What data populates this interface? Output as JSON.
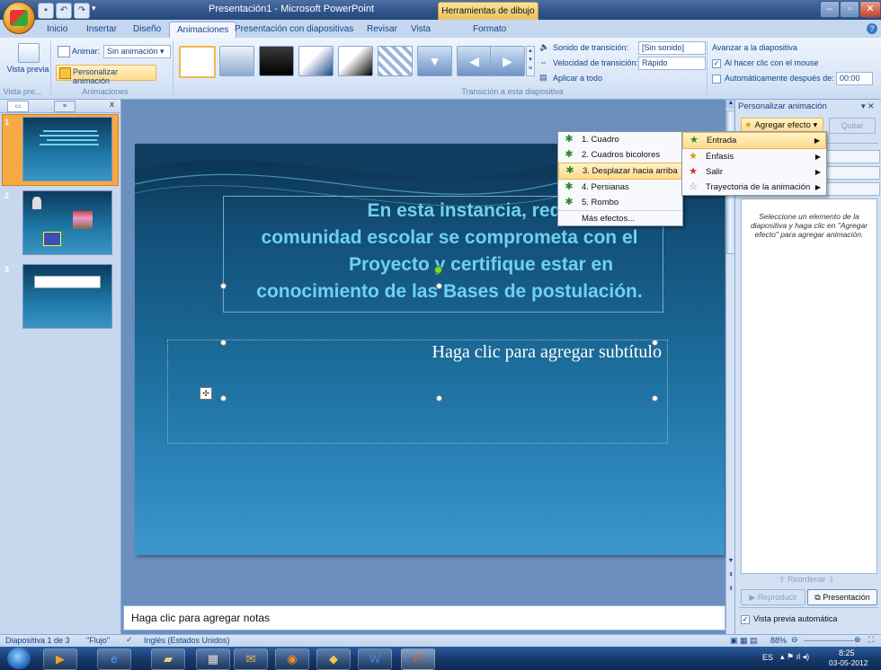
{
  "window": {
    "title": "Presentación1 - Microsoft PowerPoint",
    "contextual_tab_group": "Herramientas de dibujo"
  },
  "tabs": [
    {
      "label": "Inicio"
    },
    {
      "label": "Insertar"
    },
    {
      "label": "Diseño"
    },
    {
      "label": "Animaciones"
    },
    {
      "label": "Presentación con diapositivas"
    },
    {
      "label": "Revisar"
    },
    {
      "label": "Vista"
    },
    {
      "label": "Formato"
    }
  ],
  "ribbon": {
    "preview_label": "Vista previa",
    "preview_group": "Vista pre...",
    "animar_label": "Animar:",
    "animar_value": "Sin animación",
    "personalizar_label": "Personalizar animación",
    "animaciones_group": "Animaciones",
    "sonido_label": "Sonido de transición:",
    "sonido_value": "[Sin sonido]",
    "velocidad_label": "Velocidad de transición:",
    "velocidad_value": "Rápido",
    "aplicar_label": "Aplicar a todo",
    "transicion_group": "Transición a esta diapositiva",
    "avanzar_label": "Avanzar a la diapositiva",
    "al_hacer_clic": "Al hacer clic con el mouse",
    "auto_label": "Automáticamente después de:",
    "auto_value": "00:00"
  },
  "slides": [
    {
      "num": "1"
    },
    {
      "num": "2"
    },
    {
      "num": "3"
    }
  ],
  "slide": {
    "title_lines": [
      "En esta instancia, requerim",
      "comunidad escolar se comprometa con el",
      "Proyecto y certifique estar en",
      "conocimiento de las Bases de postulación."
    ],
    "subtitle_placeholder": "Haga clic para agregar subtítulo"
  },
  "notes_placeholder": "Haga clic para agregar notas",
  "task_pane": {
    "title": "Personalizar animación",
    "add_effect": "Agregar efecto",
    "remove": "Quitar",
    "hint": "Seleccione un elemento de la diapositiva y haga clic en \"Agregar efecto\" para agregar animación.",
    "reorder": "Reordenar",
    "play": "Reproducir",
    "slideshow": "Presentación",
    "autopreview": "Vista previa automática"
  },
  "effect_menu": [
    {
      "label": "Entrada",
      "highlighted": true
    },
    {
      "label": "Énfasis"
    },
    {
      "label": "Salir"
    },
    {
      "label": "Trayectoria de la animación"
    }
  ],
  "entrada_submenu": [
    {
      "label": "1. Cuadro"
    },
    {
      "label": "2. Cuadros bicolores"
    },
    {
      "label": "3. Desplazar hacia arriba",
      "highlighted": true
    },
    {
      "label": "4. Persianas"
    },
    {
      "label": "5. Rombo"
    },
    {
      "label": "Más efectos..."
    }
  ],
  "status": {
    "slide_info": "Diapositiva 1 de 3",
    "theme": "\"Flujo\"",
    "language": "Inglés (Estados Unidos)",
    "zoom": "88%"
  },
  "taskbar": {
    "lang": "ES",
    "time": "8:25",
    "date": "03-05-2012"
  },
  "colors": {
    "accent": "#15428b",
    "slide_title": "#6fd1f0",
    "highlight": "#ffd98a"
  }
}
